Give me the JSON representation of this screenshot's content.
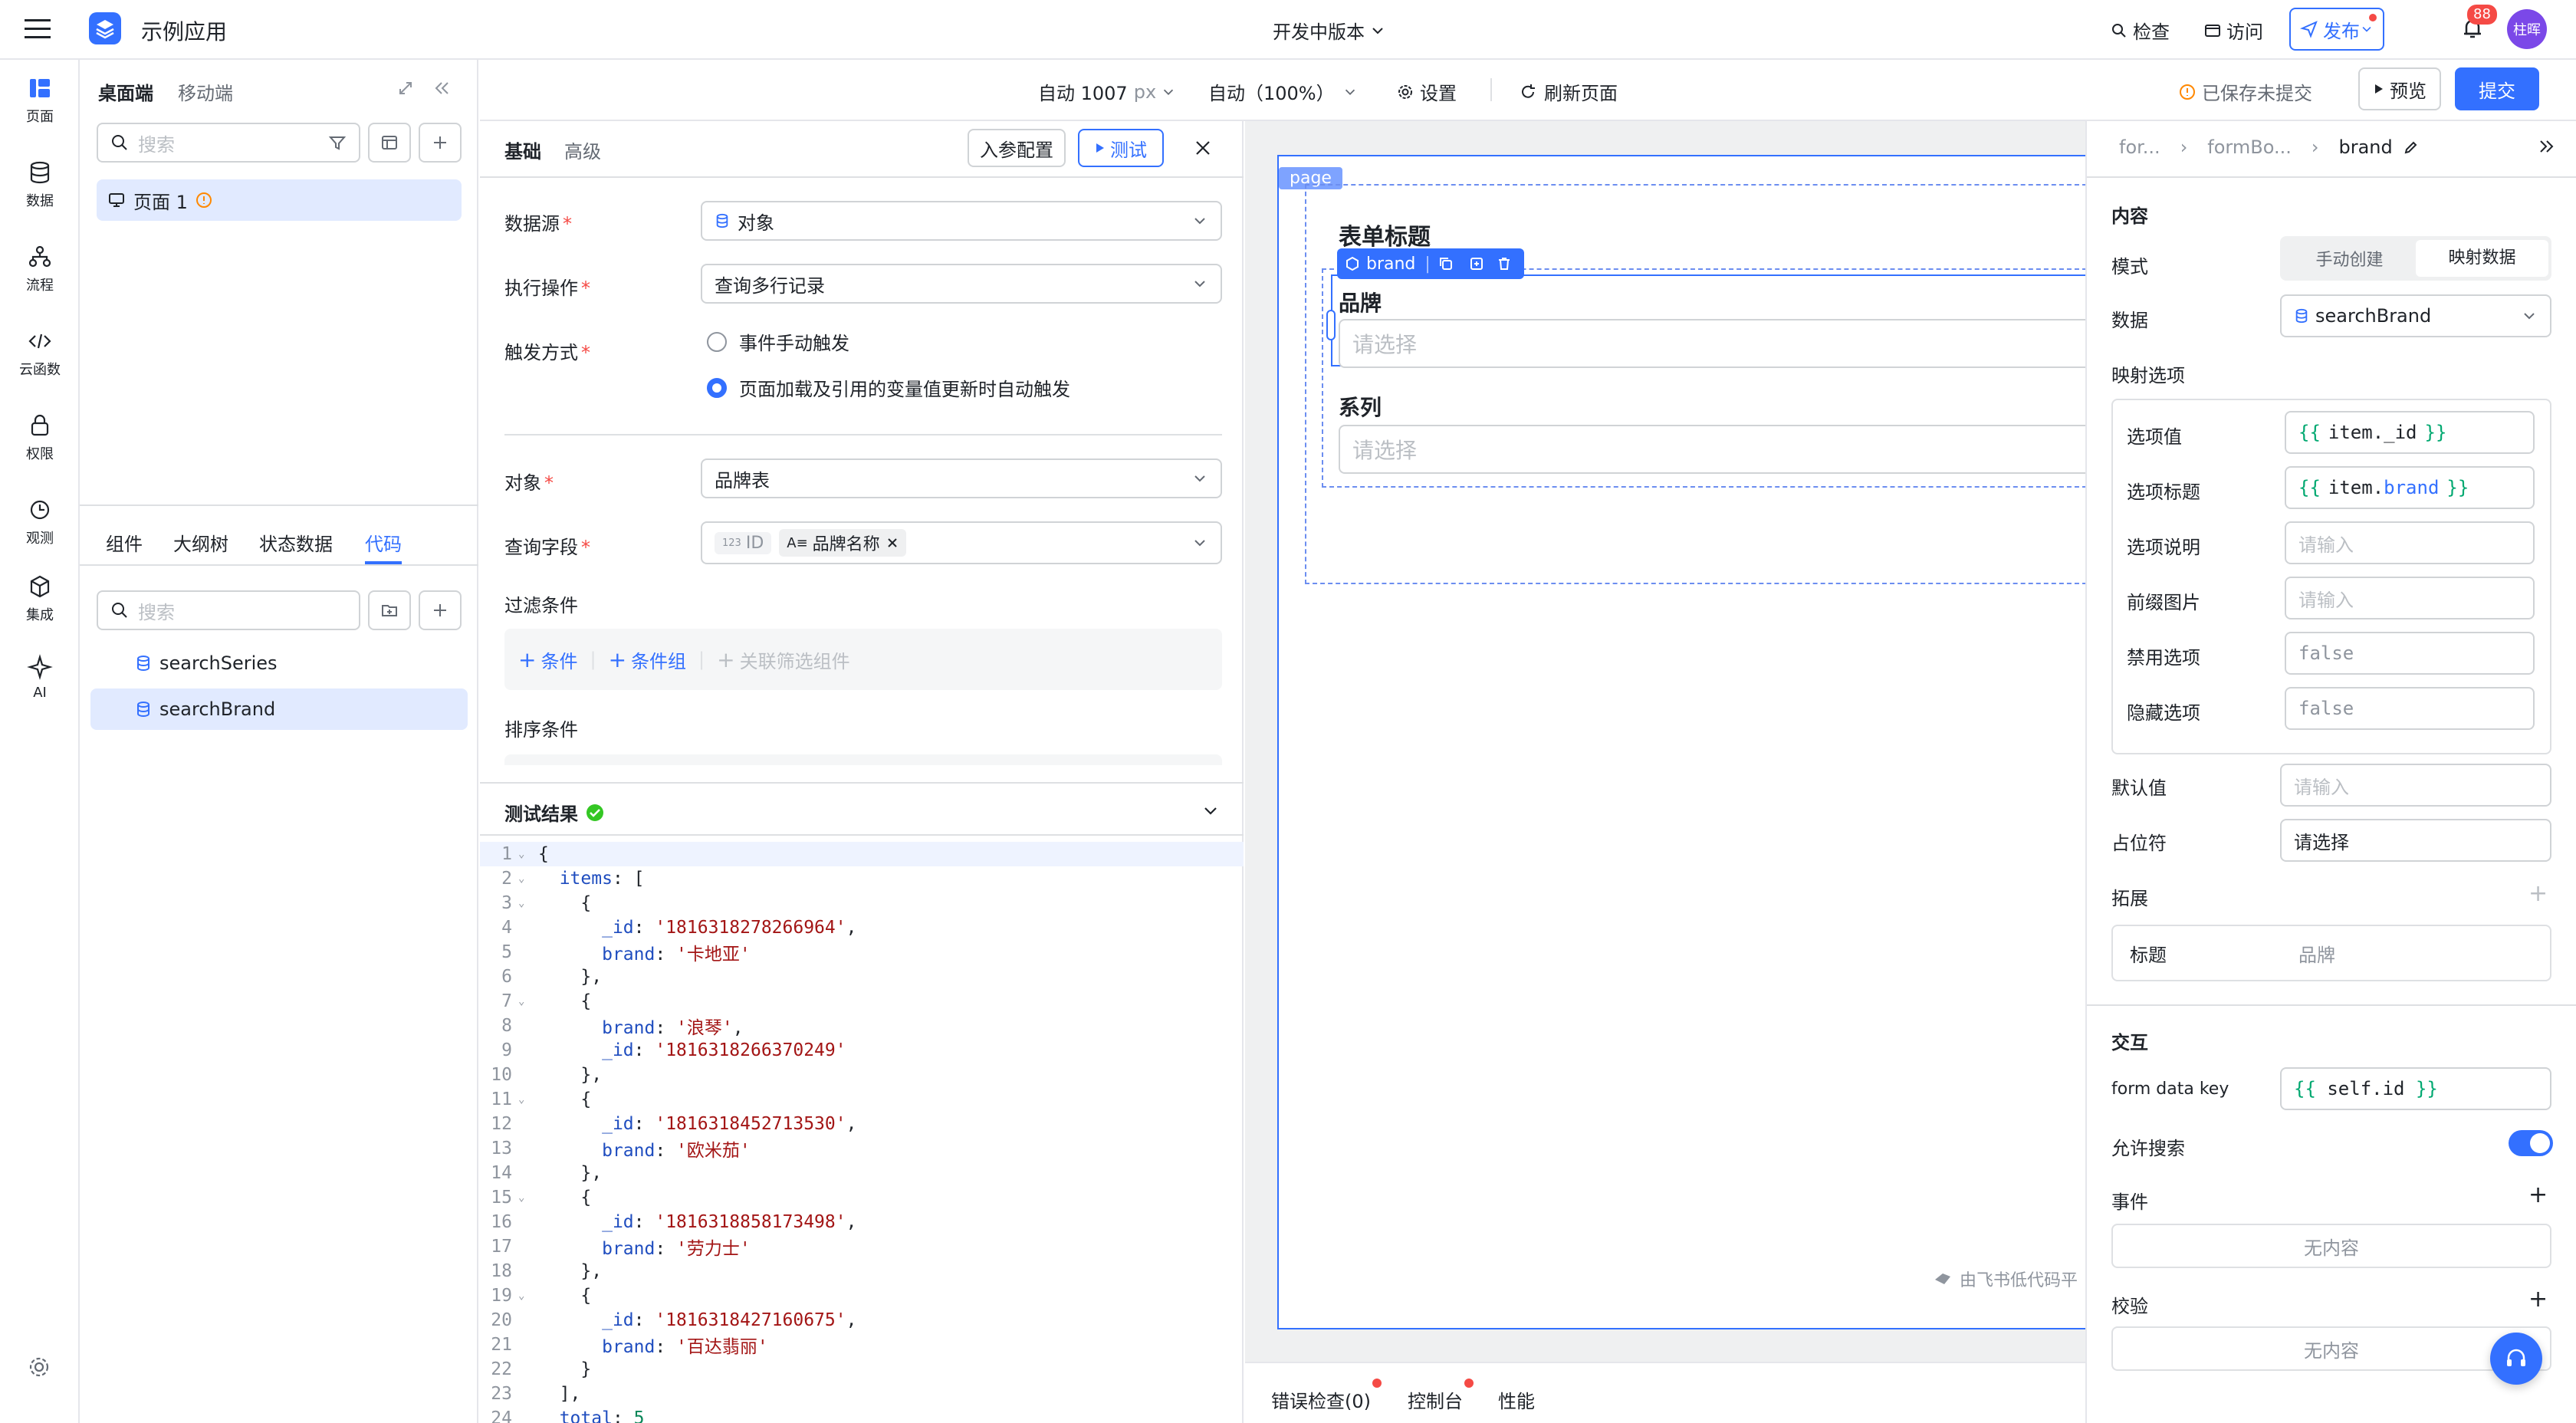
{
  "app": {
    "name": "示例应用",
    "version_label": "开发中版本"
  },
  "topbar": {
    "check": "检查",
    "visit": "访问",
    "publish": "发布",
    "notif_count": "88",
    "avatar": "柱晖"
  },
  "toolbar": {
    "width": "自动 1007",
    "width_unit": "px",
    "zoom": "自动（100%）",
    "settings": "设置",
    "refresh": "刷新页面",
    "saved_status": "已保存未提交",
    "preview": "预览",
    "submit": "提交"
  },
  "rail": [
    {
      "label": "页面",
      "icon": "page-icon"
    },
    {
      "label": "数据",
      "icon": "database-icon"
    },
    {
      "label": "流程",
      "icon": "flow-icon"
    },
    {
      "label": "云函数",
      "icon": "code-icon"
    },
    {
      "label": "权限",
      "icon": "lock-icon"
    },
    {
      "label": "观测",
      "icon": "monitor-icon"
    },
    {
      "label": "集成",
      "icon": "integration-icon"
    },
    {
      "label": "AI",
      "icon": "ai-sparkle-icon"
    }
  ],
  "left_panel": {
    "tabs": [
      "桌面端",
      "移动端"
    ],
    "search_placeholder": "搜索",
    "page_item": "页面 1",
    "bottom_tabs": [
      "组件",
      "大纲树",
      "状态数据",
      "代码"
    ],
    "active_bottom_tab": "代码",
    "search2_placeholder": "搜索",
    "code_items": [
      "searchSeries",
      "searchBrand"
    ]
  },
  "editor": {
    "tabs": [
      "基础",
      "高级"
    ],
    "params_btn": "入参配置",
    "test_btn": "测试",
    "fields": {
      "datasource_label": "数据源",
      "datasource_value": "对象",
      "operation_label": "执行操作",
      "operation_value": "查询多行记录",
      "trigger_label": "触发方式",
      "trigger_opt1": "事件手动触发",
      "trigger_opt2": "页面加载及引用的变量值更新时自动触发",
      "object_label": "对象",
      "object_value": "品牌表",
      "query_fields_label": "查询字段",
      "query_tag1": "ID",
      "query_tag2": "品牌名称",
      "filter_label": "过滤条件",
      "add_condition": "条件",
      "add_condition_group": "条件组",
      "linked_filter": "关联筛选组件",
      "sort_label": "排序条件"
    },
    "test_result_label": "测试结果",
    "code_lines": [
      "{",
      "  items: [",
      "    {",
      "      _id: '1816318278266964',",
      "      brand: '卡地亚'",
      "    },",
      "    {",
      "      brand: '浪琴',",
      "      _id: '1816318266370249'",
      "    },",
      "    {",
      "      _id: '1816318452713530',",
      "      brand: '欧米茄'",
      "    },",
      "    {",
      "      _id: '1816318858173498',",
      "      brand: '劳力士'",
      "    },",
      "    {",
      "      _id: '1816318427160675',",
      "      brand: '百达翡丽'",
      "    }",
      "  ],",
      "  total: 5"
    ]
  },
  "canvas": {
    "page_tag": "page",
    "form_title": "表单标题",
    "toolbar_name": "brand",
    "field1_label": "品牌",
    "field1_placeholder": "请选择",
    "field2_label": "系列",
    "field2_placeholder": "请选择",
    "footer_brand": "由飞书低代码平"
  },
  "bottom_tabs": [
    "错误检查(0)",
    "控制台",
    "性能"
  ],
  "props": {
    "breadcrumb": [
      "for...",
      "formBo...",
      "brand"
    ],
    "section_content": "内容",
    "mode_label": "模式",
    "mode_opts": [
      "手动创建",
      "映射数据"
    ],
    "data_label": "数据",
    "data_value": "searchBrand",
    "mapping_label": "映射选项",
    "mapping": [
      {
        "label": "选项值",
        "value": "item._id",
        "kind": "code"
      },
      {
        "label": "选项标题",
        "value": "item.brand",
        "kind": "code"
      },
      {
        "label": "选项说明",
        "value": "请输入",
        "kind": "placeholder"
      },
      {
        "label": "前缀图片",
        "value": "请输入",
        "kind": "placeholder"
      },
      {
        "label": "禁用选项",
        "value": "false",
        "kind": "mono"
      },
      {
        "label": "隐藏选项",
        "value": "false",
        "kind": "mono"
      }
    ],
    "default_label": "默认值",
    "default_placeholder": "请输入",
    "placeholder_label": "占位符",
    "placeholder_value": "请选择",
    "extend_label": "拓展",
    "extend_title_label": "标题",
    "extend_title_value": "品牌",
    "section_interaction": "交互",
    "form_key_label": "form data key",
    "form_key_value": "self.id",
    "allow_search_label": "允许搜索",
    "events_label": "事件",
    "events_empty": "无内容",
    "validate_label": "校验",
    "validate_empty": "无内容"
  },
  "colors": {
    "accent": "#3370ff",
    "canvas_bg": "#eff0f1",
    "success": "#34c724",
    "danger": "#f54a45"
  }
}
